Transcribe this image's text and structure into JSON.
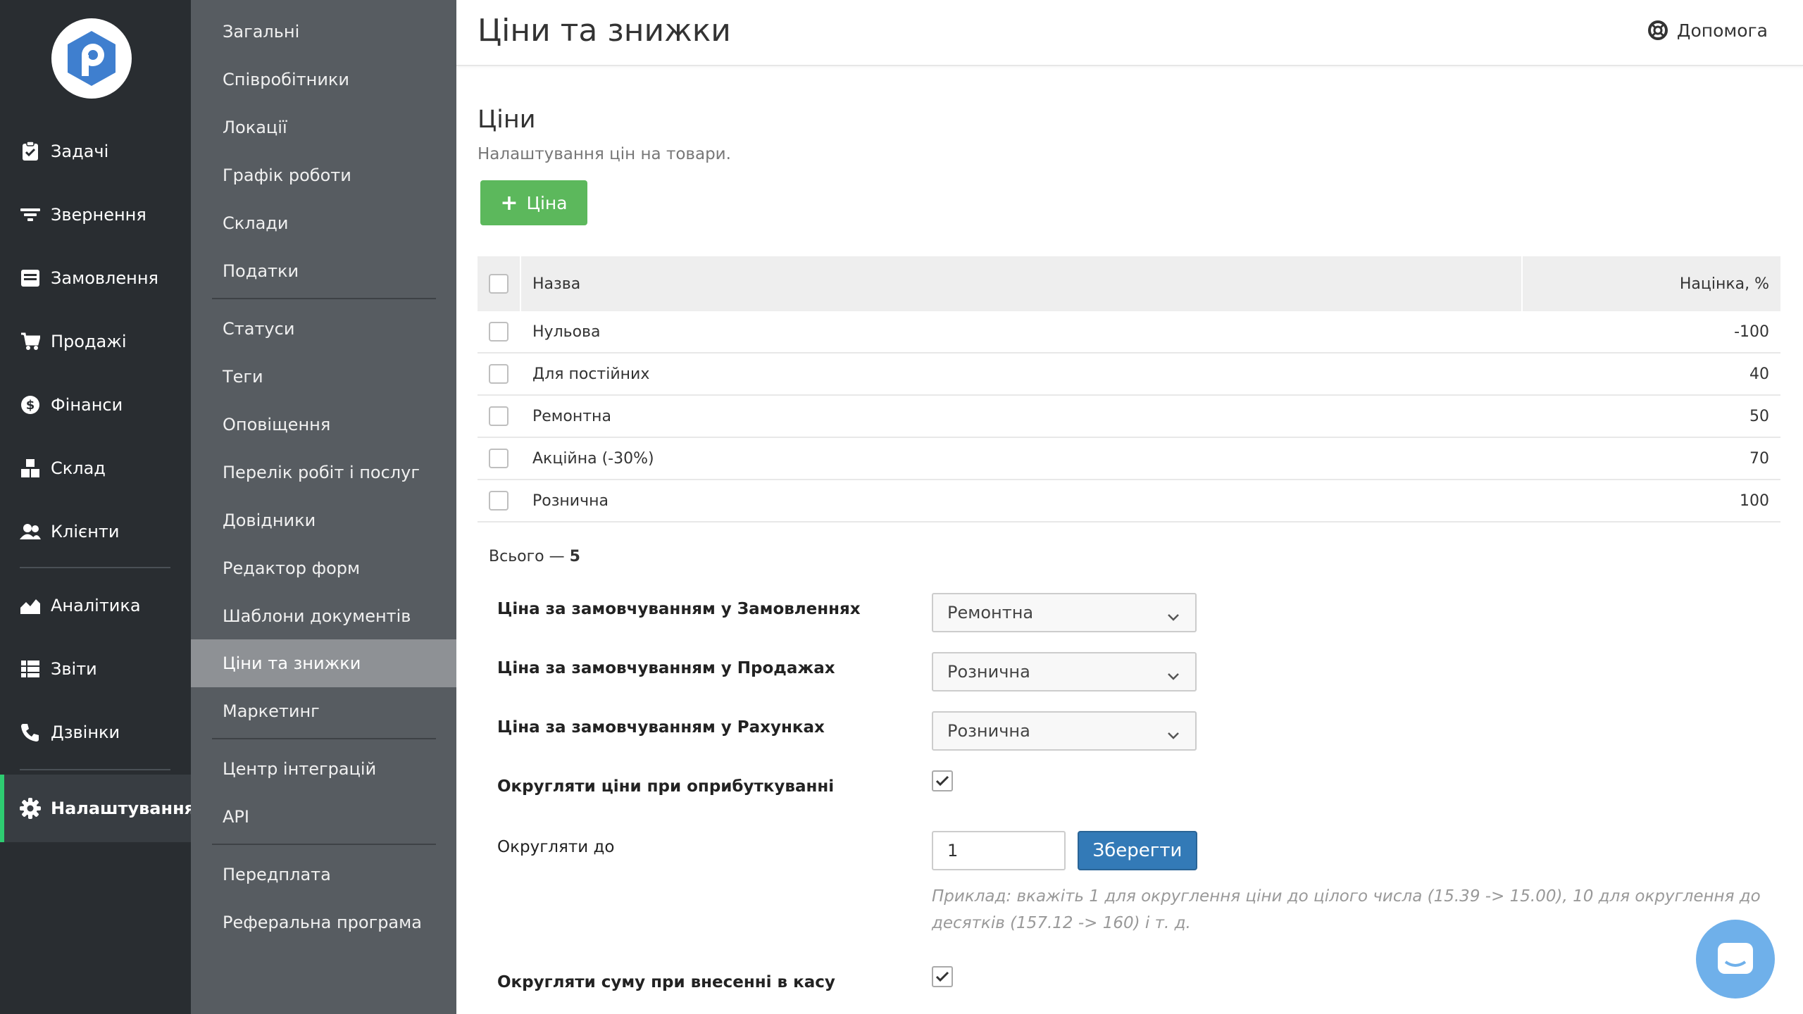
{
  "app": {
    "accent": "#2ecc71",
    "primary_button_color": "#5cb85c",
    "save_button_color": "#337ab7"
  },
  "nav": {
    "items": [
      {
        "label": "Задачі",
        "icon": "clipboard-check-icon"
      },
      {
        "label": "Звернення",
        "icon": "filter-icon"
      },
      {
        "label": "Замовлення",
        "icon": "order-list-icon"
      },
      {
        "label": "Продажі",
        "icon": "cart-icon"
      },
      {
        "label": "Фінанси",
        "icon": "dollar-icon"
      },
      {
        "label": "Склад",
        "icon": "boxes-icon"
      },
      {
        "label": "Клієнти",
        "icon": "users-icon"
      },
      {
        "label": "Аналітика",
        "icon": "area-chart-icon"
      },
      {
        "label": "Звіти",
        "icon": "table-icon"
      },
      {
        "label": "Дзвінки",
        "icon": "phone-icon"
      },
      {
        "label": "Налаштування",
        "icon": "gear-icon"
      }
    ]
  },
  "subnav": {
    "items": [
      "Загальні",
      "Співробітники",
      "Локації",
      "Графік роботи",
      "Склади",
      "Податки",
      "Статуси",
      "Теги",
      "Оповіщення",
      "Перелік робіт і послуг",
      "Довідники",
      "Редактор форм",
      "Шаблони документів",
      "Ціни та знижки",
      "Маркетинг",
      "Центр інтеграцій",
      "API",
      "Передплата",
      "Реферальна програма"
    ]
  },
  "header": {
    "title": "Ціни та знижки",
    "help": "Допомога"
  },
  "prices": {
    "title": "Ціни",
    "description": "Налаштування цін на товари.",
    "add_button": "Ціна",
    "columns": {
      "name": "Назва",
      "markup": "Націнка, %"
    },
    "rows": [
      {
        "name": "Нульова",
        "markup": "-100"
      },
      {
        "name": "Для постійних",
        "markup": "40"
      },
      {
        "name": "Ремонтна",
        "markup": "50"
      },
      {
        "name": "Акційна (-30%)",
        "markup": "70"
      },
      {
        "name": "Рознична",
        "markup": "100"
      }
    ],
    "total_label": "Всього —",
    "total_count": "5"
  },
  "settings": {
    "orders_label": "Ціна за замовчуванням у Замовленнях",
    "orders_value": "Ремонтна",
    "sales_label": "Ціна за замовчуванням у Продажах",
    "sales_value": "Рознична",
    "invoices_label": "Ціна за замовчуванням у Рахунках",
    "invoices_value": "Рознична",
    "round_on_posting_label": "Округляти ціни при оприбуткуванні",
    "round_on_posting_checked": true,
    "round_to_label": "Округляти до",
    "round_to_value": "1",
    "save_button": "Зберегти",
    "hint": "Приклад: вкажіть 1 для округлення ціни до цілого числа (15.39 -> 15.00), 10 для округлення до десятків (157.12 -> 160) і т. д.",
    "round_cash_label": "Округляти суму при внесенні в касу",
    "round_cash_checked": true
  }
}
